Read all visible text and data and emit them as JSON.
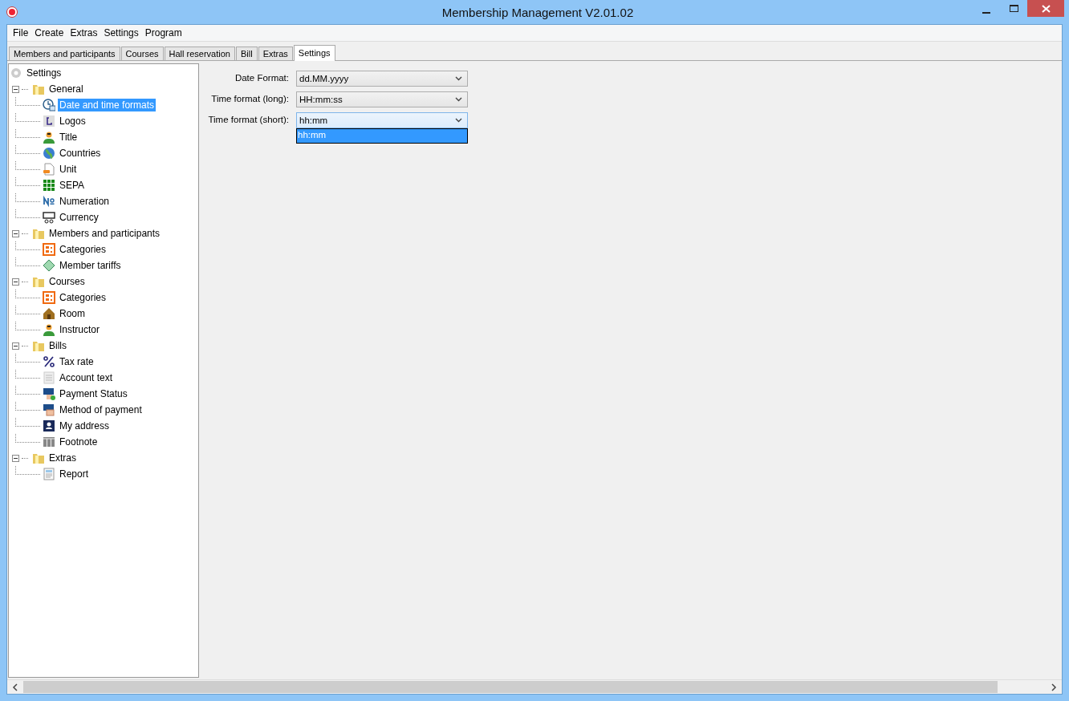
{
  "window": {
    "title": "Membership Management V2.01.02"
  },
  "menu": [
    "File",
    "Create",
    "Extras",
    "Settings",
    "Program"
  ],
  "tabs": [
    {
      "label": "Members and participants",
      "selected": false
    },
    {
      "label": "Courses",
      "selected": false
    },
    {
      "label": "Hall reservation",
      "selected": false
    },
    {
      "label": "Bill",
      "selected": false
    },
    {
      "label": "Extras",
      "selected": false
    },
    {
      "label": "Settings",
      "selected": true
    }
  ],
  "tree": {
    "label": "Settings",
    "children": [
      {
        "label": "General",
        "expanded": true,
        "children": [
          {
            "label": "Date and time formats",
            "selected": true
          },
          {
            "label": "Logos",
            "selected": false
          },
          {
            "label": "Title",
            "selected": false
          },
          {
            "label": "Countries",
            "selected": false
          },
          {
            "label": "Unit",
            "selected": false
          },
          {
            "label": "SEPA",
            "selected": false
          },
          {
            "label": "Numeration",
            "selected": false
          },
          {
            "label": "Currency",
            "selected": false
          }
        ]
      },
      {
        "label": "Members and participants",
        "expanded": true,
        "children": [
          {
            "label": "Categories",
            "selected": false
          },
          {
            "label": "Member tariffs",
            "selected": false
          }
        ]
      },
      {
        "label": "Courses",
        "expanded": true,
        "children": [
          {
            "label": "Categories",
            "selected": false
          },
          {
            "label": "Room",
            "selected": false
          },
          {
            "label": "Instructor",
            "selected": false
          }
        ]
      },
      {
        "label": "Bills",
        "expanded": true,
        "children": [
          {
            "label": "Tax rate",
            "selected": false
          },
          {
            "label": "Account text",
            "selected": false
          },
          {
            "label": "Payment Status",
            "selected": false
          },
          {
            "label": "Method of payment",
            "selected": false
          },
          {
            "label": "My address",
            "selected": false
          },
          {
            "label": "Footnote",
            "selected": false
          }
        ]
      },
      {
        "label": "Extras",
        "expanded": true,
        "children": [
          {
            "label": "Report",
            "selected": false
          }
        ]
      }
    ]
  },
  "fields": [
    {
      "label": "Date Format:",
      "value": "dd.MM.yyyy",
      "open": false
    },
    {
      "label": "Time format (long):",
      "value": "HH:mm:ss",
      "open": false
    },
    {
      "label": "Time format (short):",
      "value": "hh:mm",
      "open": true,
      "options": [
        {
          "label": "hh:mm",
          "selected": true
        }
      ]
    }
  ]
}
